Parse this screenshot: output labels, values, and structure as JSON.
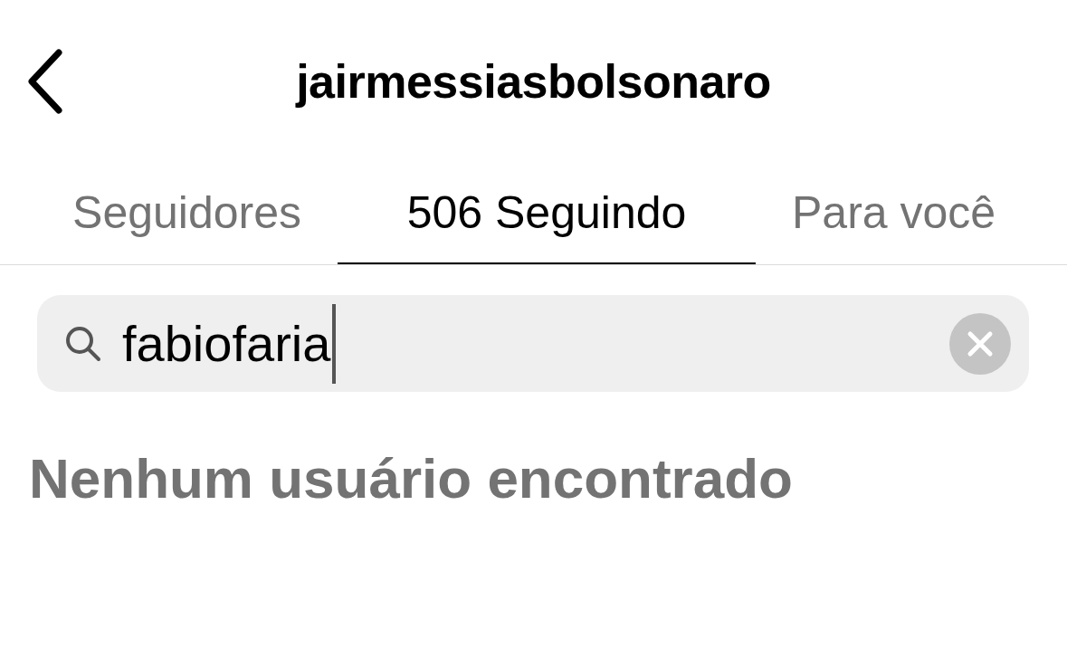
{
  "header": {
    "title": "jairmessiasbolsonaro"
  },
  "tabs": [
    {
      "label": "Seguidores",
      "selected": false
    },
    {
      "label": "506 Seguindo",
      "selected": true
    },
    {
      "label": "Para você",
      "selected": false
    }
  ],
  "search": {
    "value": "fabiofaria",
    "focused": true
  },
  "message": "Nenhum usuário encontrado"
}
